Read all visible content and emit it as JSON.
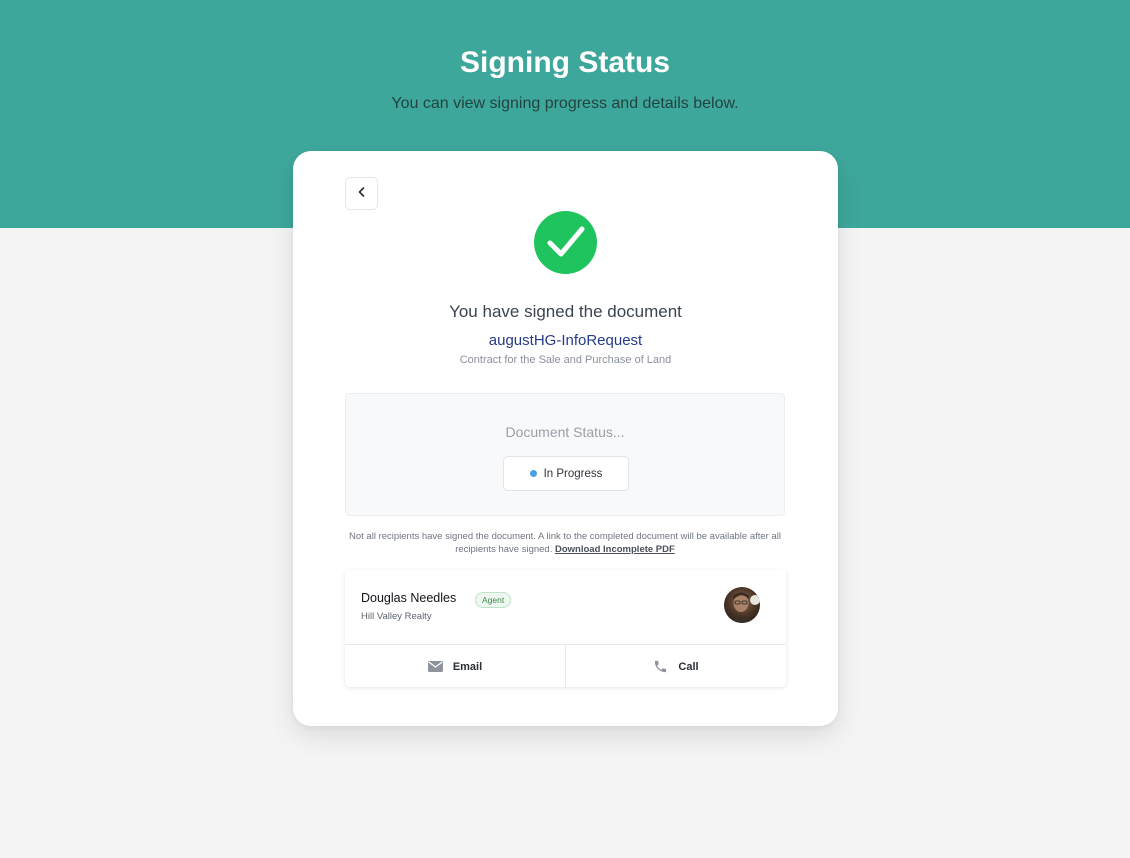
{
  "header": {
    "title": "Signing Status",
    "subtitle": "You can view signing progress and details below."
  },
  "card": {
    "back_icon": "chevron-left-icon",
    "success_icon": "check-circle-icon",
    "signed_message": "You have signed the document",
    "document_name": "augustHG-InfoRequest",
    "document_description": "Contract for the Sale and Purchase of Land"
  },
  "status": {
    "heading": "Document Status...",
    "value": "In Progress",
    "dot_color": "#4f9fe0"
  },
  "notice": {
    "text": "Not all recipients have signed the document. A link to the completed document will be available after all recipients have signed.",
    "link": "Download Incomplete PDF"
  },
  "contact": {
    "name": "Douglas Needles",
    "role": "Agent",
    "company": "Hill Valley Realty",
    "actions": [
      {
        "label": "Email",
        "icon": "envelope-icon"
      },
      {
        "label": "Call",
        "icon": "phone-icon"
      }
    ]
  },
  "colors": {
    "hero_background": "#3ea79c",
    "success_green": "#1fc45f",
    "document_link": "#243b8a",
    "page_background": "#f4f4f4"
  }
}
